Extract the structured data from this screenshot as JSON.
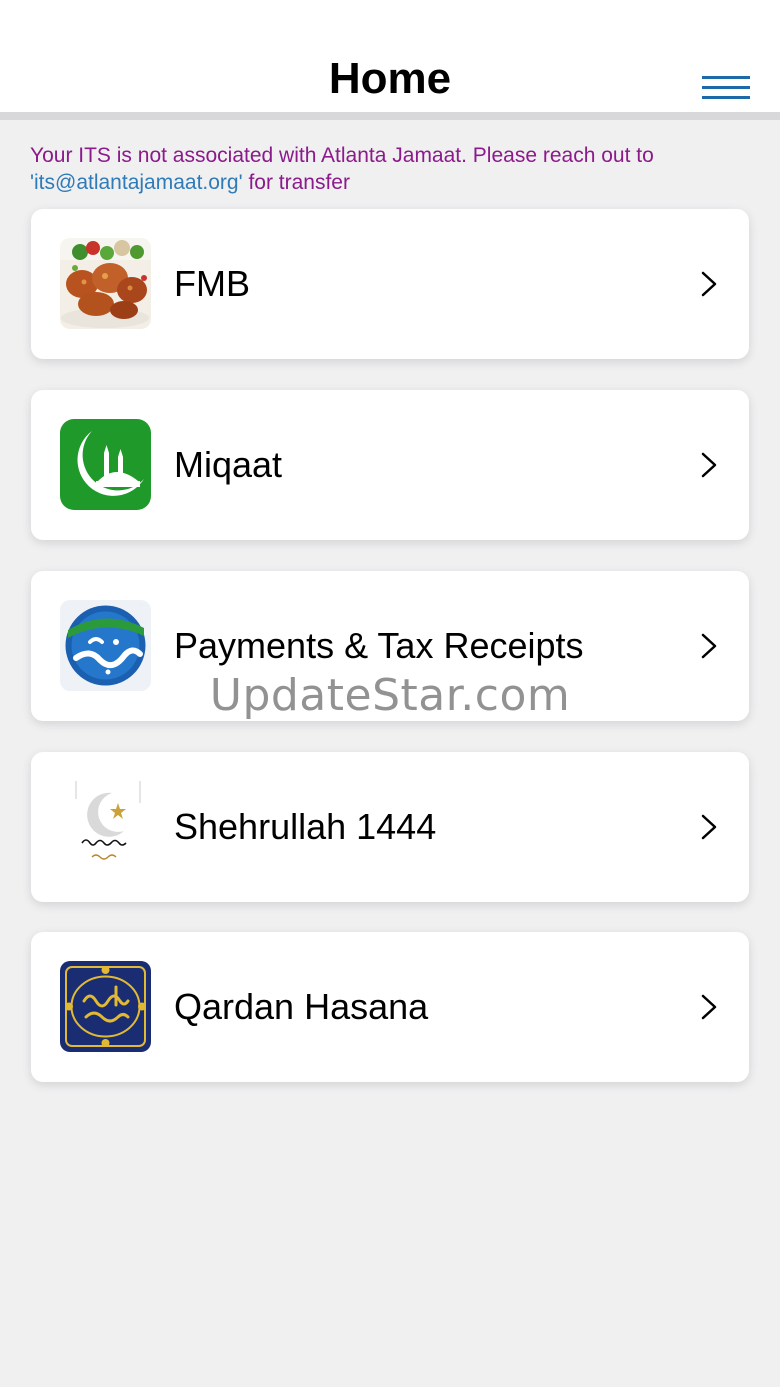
{
  "header": {
    "title": "Home"
  },
  "notice": {
    "text_before": "Your ITS is not associated with Atlanta Jamaat. Please reach out to ",
    "email": "'its@atlantajamaat.org'",
    "text_after": " for transfer"
  },
  "menu": {
    "items": [
      {
        "label": "FMB",
        "icon": "food-plate-icon"
      },
      {
        "label": "Miqaat",
        "icon": "mosque-crescent-icon"
      },
      {
        "label": "Payments & Tax Receipts",
        "icon": "sabeel-logo-icon"
      },
      {
        "label": "Shehrullah 1444",
        "icon": "ramadan-crescent-icon"
      },
      {
        "label": "Qardan Hasana",
        "icon": "qardan-hasana-logo-icon"
      }
    ]
  },
  "watermark": "UpdateStar.com",
  "colors": {
    "background": "#f0f0f1",
    "notice_text": "#8b1a8b",
    "notice_link": "#2f7ab8",
    "menu_icon": "#1e6aa8",
    "miqaat_green": "#1f9a2a",
    "sabeel_blue": "#1a5fb0",
    "qardan_navy": "#1a2c72",
    "qardan_gold": "#e2b933"
  }
}
